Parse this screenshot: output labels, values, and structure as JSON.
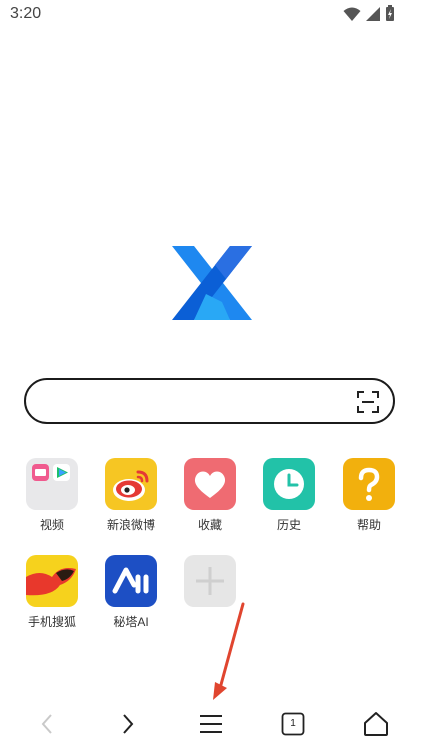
{
  "status_bar": {
    "time": "3:20"
  },
  "search": {
    "placeholder": ""
  },
  "shortcuts": [
    {
      "label": "视频",
      "icon": "video-folder-icon",
      "color": "#e8e8ea"
    },
    {
      "label": "新浪微博",
      "icon": "weibo-icon",
      "color": "#f6c623"
    },
    {
      "label": "收藏",
      "icon": "heart-icon",
      "color": "#ef6b72"
    },
    {
      "label": "历史",
      "icon": "clock-icon",
      "color": "#22c2a8"
    },
    {
      "label": "帮助",
      "icon": "question-icon",
      "color": "#f2b00d"
    },
    {
      "label": "手机搜狐",
      "icon": "sohu-fox-icon",
      "color": "#f6d21d"
    },
    {
      "label": "秘塔AI",
      "icon": "metaso-icon",
      "color": "#1d4fc4"
    },
    {
      "label": "",
      "icon": "add-icon",
      "color": "#e6e6e6"
    }
  ],
  "bottom_nav": {
    "back": "back-icon",
    "forward": "forward-icon",
    "menu": "menu-icon",
    "tabs_count": "1",
    "home": "home-icon"
  },
  "colors": {
    "logo_blue": "#1e88f0",
    "logo_dark": "#0b5fd6",
    "arrow_red": "#e0452f"
  }
}
